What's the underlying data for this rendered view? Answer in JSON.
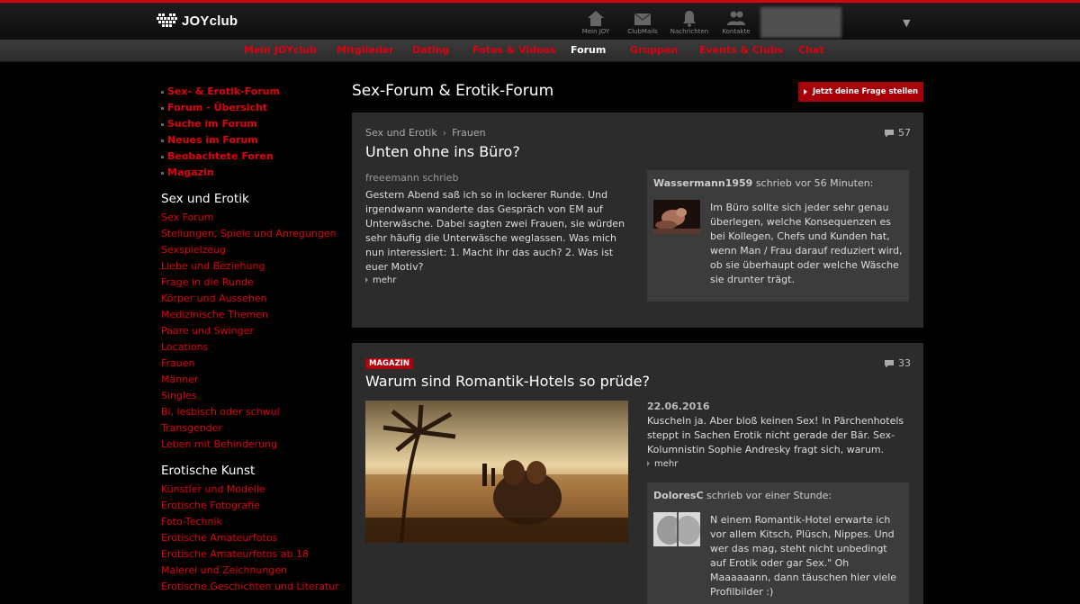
{
  "brand": {
    "logo_text": "JOYclub"
  },
  "top_icons": [
    {
      "label": "Mein JOY",
      "icon": "house-icon"
    },
    {
      "label": "ClubMails",
      "icon": "envelope-icon"
    },
    {
      "label": "Nachrichten",
      "icon": "bell-icon"
    },
    {
      "label": "Kontakte",
      "icon": "people-icon"
    }
  ],
  "nav": [
    "Mein JOYclub",
    "Mitglieder",
    "Dating",
    "Fotos & Videos",
    "Forum",
    "Gruppen",
    "Events & Clubs",
    "Chat"
  ],
  "nav_active": "Forum",
  "sidebar": {
    "top_links": [
      "Sex- & Erotik-Forum",
      "Forum - Übersicht",
      "Suche im Forum",
      "Neues im Forum",
      "Beobachtete Foren",
      "Magazin"
    ],
    "sections": [
      {
        "title": "Sex und Erotik",
        "links": [
          "Sex Forum",
          "Stellungen, Spiele und Anregungen",
          "Sexspielzeug",
          "Liebe und Beziehung",
          "Frage in die Runde",
          "Körper und Aussehen",
          "Medizinische Themen",
          "Paare und Swinger",
          "Locations",
          "Frauen",
          "Männer",
          "Singles",
          "Bi, lesbisch oder schwul",
          "Transgender",
          "Leben mit Behinderung"
        ]
      },
      {
        "title": "Erotische Kunst",
        "links": [
          "Künstler und Modelle",
          "Erotische Fotografie",
          "Foto-Technik",
          "Erotische Amateurfotos",
          "Erotische Amateurfotos ab 18",
          "Malerei und Zeichnungen",
          "Erotische Geschichten und Literatur"
        ]
      }
    ]
  },
  "main": {
    "title": "Sex-Forum & Erotik-Forum",
    "ask_button": "Jetzt deine Frage stellen"
  },
  "threads": [
    {
      "crumb": [
        "Sex und Erotik",
        "Frauen"
      ],
      "count": "57",
      "title": "Unten ohne ins Büro?",
      "author_line": "freeemann schrieb",
      "excerpt": "Gestern Abend saß ich so in lockerer Runde. Und irgendwann wanderte das Gespräch von EM auf Unterwäsche. Dabei sagten zwei Frauen, sie würden sehr häufig die Unterwäsche weglassen. Was mich nun interessiert: 1. Macht ihr das auch? 2. Was ist euer Motiv?",
      "more": "mehr",
      "reply": {
        "user": "Wassermann1959",
        "meta": "schrieb vor 56 Minuten:",
        "text": "Im Büro sollte sich jeder sehr genau überlegen, welche Konsequenzen es bei Kollegen, Chefs und Kunden hat, wenn Man / Frau darauf reduziert wird, ob sie überhaupt oder welche Wäsche sie drunter trägt."
      }
    },
    {
      "badge": "MAGAZIN",
      "count": "33",
      "title": "Warum sind Romantik-Hotels so prüde?",
      "date": "22.06.2016",
      "excerpt": "Kuscheln ja. Aber bloß keinen Sex! In Pärchenhotels steppt in Sachen Erotik nicht gerade der Bär. Sex-Kolumnistin Sophie Andresky fragt sich, warum.",
      "more": "mehr",
      "reply": {
        "user": "DoloresC",
        "meta": "schrieb vor einer Stunde:",
        "text": "N einem Romantik-Hotel erwarte ich vor allem Kitsch, Plüsch, Nippes. Und wer das mag, steht nicht unbedingt auf Erotik oder gar Sex.\" Oh Maaaaaann, dann täuschen hier viele Profilbilder :)"
      }
    }
  ],
  "colors": {
    "brand_red": "#e0000f",
    "button_red": "#a8000b",
    "card_bg": "#2c2c2c",
    "reply_bg": "#3c3c3c"
  }
}
